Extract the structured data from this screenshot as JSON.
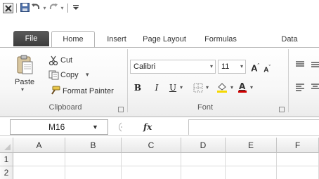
{
  "qat": {
    "icons": [
      "excel-app-icon",
      "save-icon",
      "undo-icon",
      "redo-icon",
      "customize-qat-icon"
    ]
  },
  "tabs": {
    "file": "File",
    "home": "Home",
    "insert": "Insert",
    "page_layout": "Page Layout",
    "formulas": "Formulas",
    "data": "Data"
  },
  "clipboard": {
    "paste": "Paste",
    "cut": "Cut",
    "copy": "Copy",
    "copy_arrow": "▾",
    "format_painter": "Format Painter",
    "label": "Clipboard"
  },
  "font": {
    "name": "Calibri",
    "size": "11",
    "grow": "A",
    "shrink": "A",
    "bold": "B",
    "italic": "I",
    "underline": "U",
    "label": "Font"
  },
  "formula_bar": {
    "name_box": "M16",
    "fx": "fx",
    "value": ""
  },
  "grid": {
    "columns": [
      "A",
      "B",
      "C",
      "D",
      "E",
      "F"
    ],
    "rows": [
      "1",
      "2"
    ]
  },
  "colors": {
    "file_tab": "#4a4a4a",
    "ribbon_border": "#b6b6b6",
    "highlight_yellow": "#f5d800",
    "font_red": "#d00000"
  }
}
